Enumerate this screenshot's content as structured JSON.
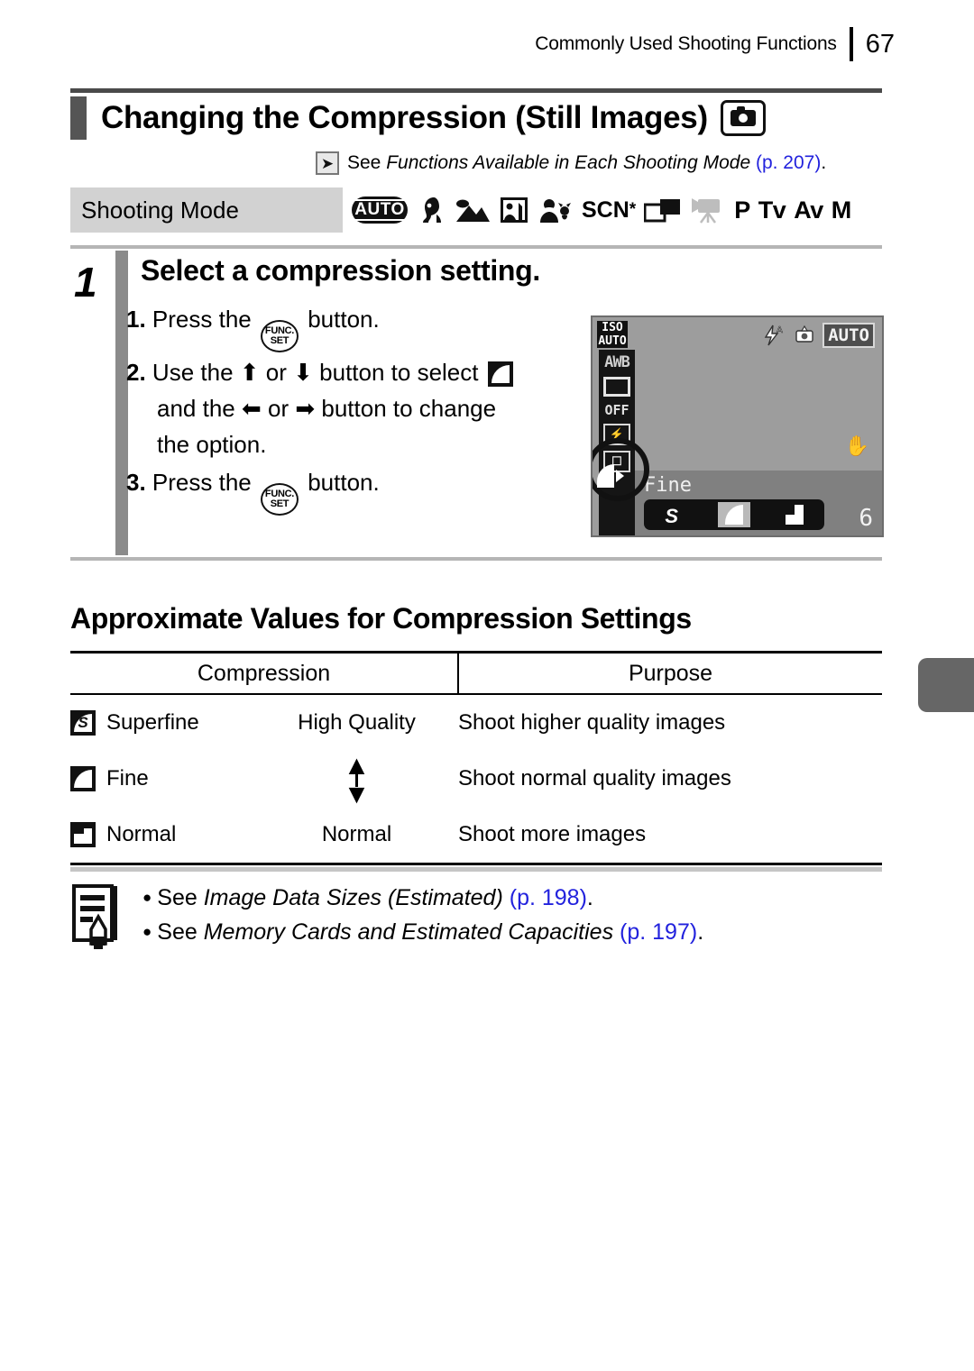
{
  "header": {
    "chapter_title": "Commonly Used Shooting Functions",
    "page_number": "67"
  },
  "title": {
    "text": "Changing the Compression (Still Images)",
    "icon": "still-camera-icon"
  },
  "cross_reference": {
    "arrow_icon": "arrow-right-icon",
    "prefix": "See ",
    "italic_title": "Functions Available in Each Shooting Mode",
    "page_ref": "(p. 207)",
    "suffix": "."
  },
  "shooting_mode": {
    "label": "Shooting Mode",
    "icons": [
      {
        "name": "auto-mode-icon",
        "label": "AUTO"
      },
      {
        "name": "portrait-mode-icon",
        "label": "Portrait"
      },
      {
        "name": "landscape-mode-icon",
        "label": "Landscape"
      },
      {
        "name": "night-snapshot-mode-icon",
        "label": "Night Snapshot"
      },
      {
        "name": "kids-and-pets-mode-icon",
        "label": "Kids & Pets"
      },
      {
        "name": "scene-mode-icon",
        "label": "SCN"
      },
      {
        "name": "stitch-assist-mode-icon",
        "label": "Stitch Assist"
      },
      {
        "name": "movie-mode-icon",
        "label": "Movie"
      },
      {
        "name": "program-mode-icon",
        "label": "P"
      },
      {
        "name": "shutter-priority-mode-icon",
        "label": "Tv"
      },
      {
        "name": "aperture-priority-mode-icon",
        "label": "Av"
      },
      {
        "name": "manual-mode-icon",
        "label": "M"
      }
    ],
    "scn_text": "SCN",
    "scn_asterisk": "*",
    "p_text": "P",
    "tv_text": "Tv",
    "av_text": "Av",
    "m_text": "M"
  },
  "step": {
    "number": "1",
    "heading": "Select a compression setting.",
    "substeps": [
      {
        "num": "1.",
        "before": "Press the ",
        "after": " button."
      },
      {
        "num": "2.",
        "line1_a": "Use the ",
        "line1_b": " or ",
        "line1_c": " button to select ",
        "line2_a": "and the ",
        "line2_b": " or ",
        "line2_c": " button to change",
        "line3": "the option."
      },
      {
        "num": "3.",
        "before": "Press the ",
        "after": " button."
      }
    ],
    "func_button_line1": "FUNC.",
    "func_button_line2": "SET",
    "arrow_up": "⬆",
    "arrow_down": "⬇",
    "arrow_left": "⬅",
    "arrow_right": "➡"
  },
  "lcd": {
    "iso_line1": "ISO",
    "iso_line2": "AUTO",
    "white_balance": "AWB",
    "flash_off": "OFF",
    "flash_auto_icon": "flash-auto-icon",
    "red_eye_icon": "red-eye-correction-icon",
    "mode_badge": "AUTO",
    "hand_icon": "camera-shake-warning-icon",
    "func_label": "Fine",
    "options": [
      {
        "name": "option-superfine",
        "glyph": "S"
      },
      {
        "name": "option-fine",
        "glyph": ""
      },
      {
        "name": "option-normal",
        "glyph": ""
      }
    ],
    "selected_option_index": 1,
    "shots_remaining": "6"
  },
  "section": {
    "heading": "Approximate Values for Compression Settings"
  },
  "table": {
    "headers": [
      "Compression",
      "Purpose"
    ],
    "rows": [
      {
        "icon": "superfine-compression-icon",
        "name": "Superfine",
        "quality": "High Quality",
        "purpose": "Shoot higher quality images"
      },
      {
        "icon": "fine-compression-icon",
        "name": "Fine",
        "quality": "",
        "purpose": "Shoot normal quality images"
      },
      {
        "icon": "normal-compression-icon",
        "name": "Normal",
        "quality": "Normal",
        "purpose": "Shoot more images"
      }
    ]
  },
  "notes": {
    "icon": "note-pencil-icon",
    "items": [
      {
        "prefix": "See ",
        "italic": "Image Data Sizes (Estimated)",
        "page_ref": "(p. 198)",
        "suffix": "."
      },
      {
        "prefix": "See ",
        "italic": "Memory Cards and Estimated Capacities",
        "page_ref": "(p. 197)",
        "suffix": "."
      }
    ]
  },
  "colors": {
    "page_ref_blue": "#2222dd",
    "rule_gray": "#8b8b8b",
    "band_gray": "#d2d2d2",
    "tab_gray": "#666666"
  }
}
